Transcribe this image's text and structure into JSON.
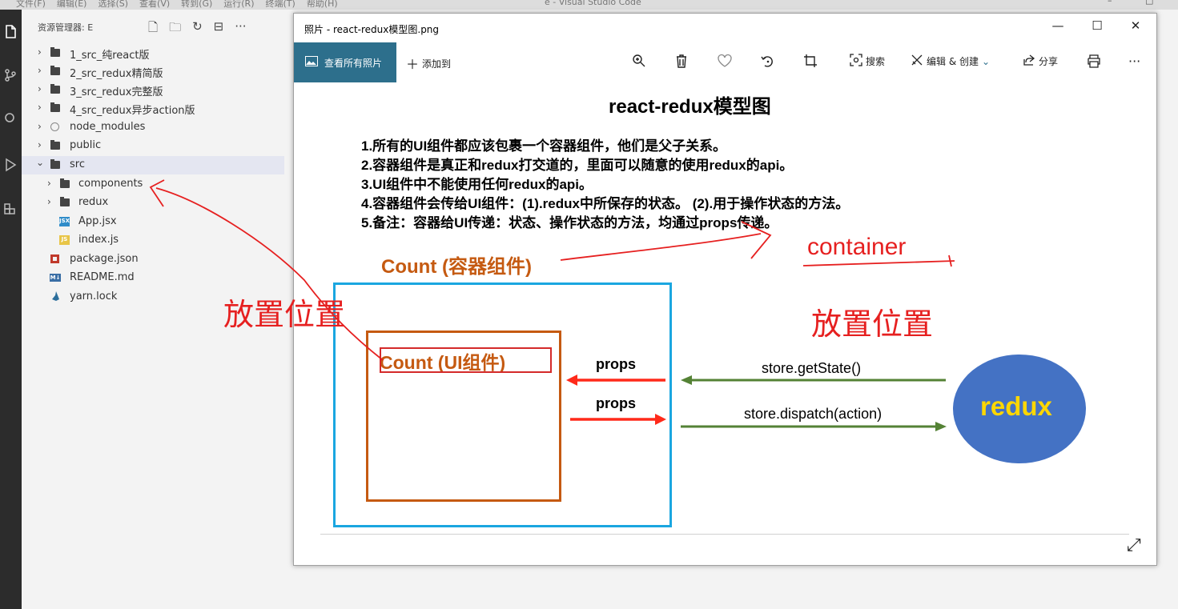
{
  "vscode": {
    "menu": [
      "文件(F)",
      "编辑(E)",
      "选择(S)",
      "查看(V)",
      "转到(G)",
      "运行(R)",
      "终端(T)",
      "帮助(H)"
    ],
    "window_title": "e - Visual Studio Code"
  },
  "explorer": {
    "header": "资源管理器: E",
    "items": [
      {
        "label": "1_src_纯react版",
        "type": "folder",
        "expanded": false
      },
      {
        "label": "2_src_redux精简版",
        "type": "folder",
        "expanded": false
      },
      {
        "label": "3_src_redux完整版",
        "type": "folder",
        "expanded": false
      },
      {
        "label": "4_src_redux异步action版",
        "type": "folder",
        "expanded": false
      },
      {
        "label": "node_modules",
        "type": "folder",
        "expanded": false
      },
      {
        "label": "public",
        "type": "folder",
        "expanded": false
      },
      {
        "label": "src",
        "type": "folder",
        "expanded": true
      },
      {
        "label": "components",
        "type": "folder",
        "expanded": false
      },
      {
        "label": "redux",
        "type": "folder",
        "expanded": false
      },
      {
        "label": "App.jsx",
        "type": "jsx"
      },
      {
        "label": "index.js",
        "type": "js"
      },
      {
        "label": "package.json",
        "type": "json"
      },
      {
        "label": "README.md",
        "type": "md"
      },
      {
        "label": "yarn.lock",
        "type": "yarn"
      }
    ],
    "icon_badges": {
      "jsx": "JSX",
      "js": "JS",
      "md": "M↓"
    }
  },
  "photos": {
    "title": "照片 - react-redux模型图.png",
    "toolbar": {
      "view_all": "查看所有照片",
      "add_to": "添加到",
      "search": "搜索",
      "edit_create": "编辑 & 创建",
      "share": "分享"
    },
    "window_controls": {
      "minimize": "—",
      "maximize": "☐",
      "close": "✕"
    }
  },
  "diagram": {
    "title": "react-redux模型图",
    "rules": [
      "1.所有的UI组件都应该包裹一个容器组件，他们是父子关系。",
      "2.容器组件是真正和redux打交道的，里面可以随意的使用redux的api。",
      "3.UI组件中不能使用任何redux的api。",
      "4.容器组件会传给UI组件：(1).redux中所保存的状态。 (2).用于操作状态的方法。",
      "5.备注：容器给UI传递：状态、操作状态的方法，均通过props传递。"
    ],
    "count_container": "Count (容器组件)",
    "count_ui": "Count (UI组件)",
    "props_top": "props",
    "props_bottom": "props",
    "get_state": "store.getState()",
    "dispatch": "store.dispatch(action)",
    "redux": "redux"
  },
  "annotations": {
    "left_note": "放置位置",
    "right_note": "放置位置",
    "container_note": "container"
  },
  "colors": {
    "accent": "#2d6f8c",
    "container_box": "#1aa6e0",
    "ui_box": "#c55a11",
    "redux": "#4472c4",
    "redux_text": "#ffd700",
    "props_arrow": "#ff2a1a",
    "store_arrow": "#548235",
    "annotation": "#e62020"
  }
}
